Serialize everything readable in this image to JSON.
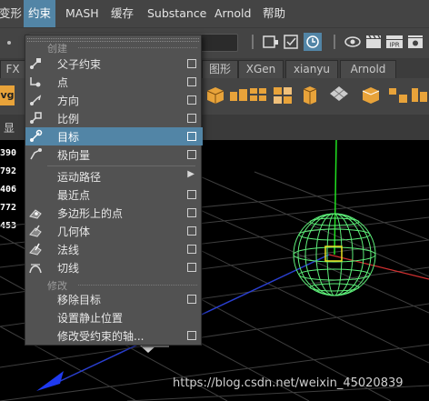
{
  "menubar": {
    "items": [
      {
        "label": "变形"
      },
      {
        "label": "约束"
      },
      {
        "label": "MASH"
      },
      {
        "label": "缓存"
      },
      {
        "label": "Substance"
      },
      {
        "label": "Arnold"
      },
      {
        "label": "帮助"
      }
    ],
    "active_color": "#5285a6"
  },
  "shelf_tabs": [
    {
      "label": "FX"
    },
    {
      "label": "图形"
    },
    {
      "label": "XGen"
    },
    {
      "label": "xianyu"
    },
    {
      "label": "Arnold"
    }
  ],
  "shelf": {
    "left_button_label": "vg"
  },
  "panel_bar": {
    "show_label": "显"
  },
  "hud_values": [
    "390",
    "792",
    "406",
    "772",
    "453"
  ],
  "constrain_menu": {
    "sections": [
      {
        "label": "创建"
      },
      {
        "label": "修改"
      }
    ],
    "items": [
      {
        "label": "父子约束",
        "icon": "parent-constraint-icon",
        "option_box": true
      },
      {
        "label": "点",
        "icon": "point-constraint-icon",
        "option_box": true
      },
      {
        "label": "方向",
        "icon": "orient-constraint-icon",
        "option_box": true
      },
      {
        "label": "比例",
        "icon": "scale-constraint-icon",
        "option_box": true
      },
      {
        "label": "目标",
        "icon": "aim-constraint-icon",
        "option_box": true,
        "highlighted": true
      },
      {
        "label": "极向量",
        "icon": "pole-vector-icon",
        "option_box": true
      },
      {
        "label": "运动路径",
        "submenu": true
      },
      {
        "label": "最近点",
        "option_box": true
      },
      {
        "label": "多边形上的点",
        "icon": "point-on-poly-icon",
        "option_box": true
      },
      {
        "label": "几何体",
        "icon": "geometry-constraint-icon",
        "option_box": true
      },
      {
        "label": "法线",
        "icon": "normal-constraint-icon",
        "option_box": true
      },
      {
        "label": "切线",
        "icon": "tangent-constraint-icon",
        "option_box": true
      },
      {
        "label": "移除目标",
        "option_box": true
      },
      {
        "label": "设置静止位置"
      },
      {
        "label": "修改受约束的轴...",
        "option_box": true
      }
    ],
    "highlight_color": "#5285a6"
  },
  "watermark": "https://blog.csdn.net/weixin_45020839"
}
